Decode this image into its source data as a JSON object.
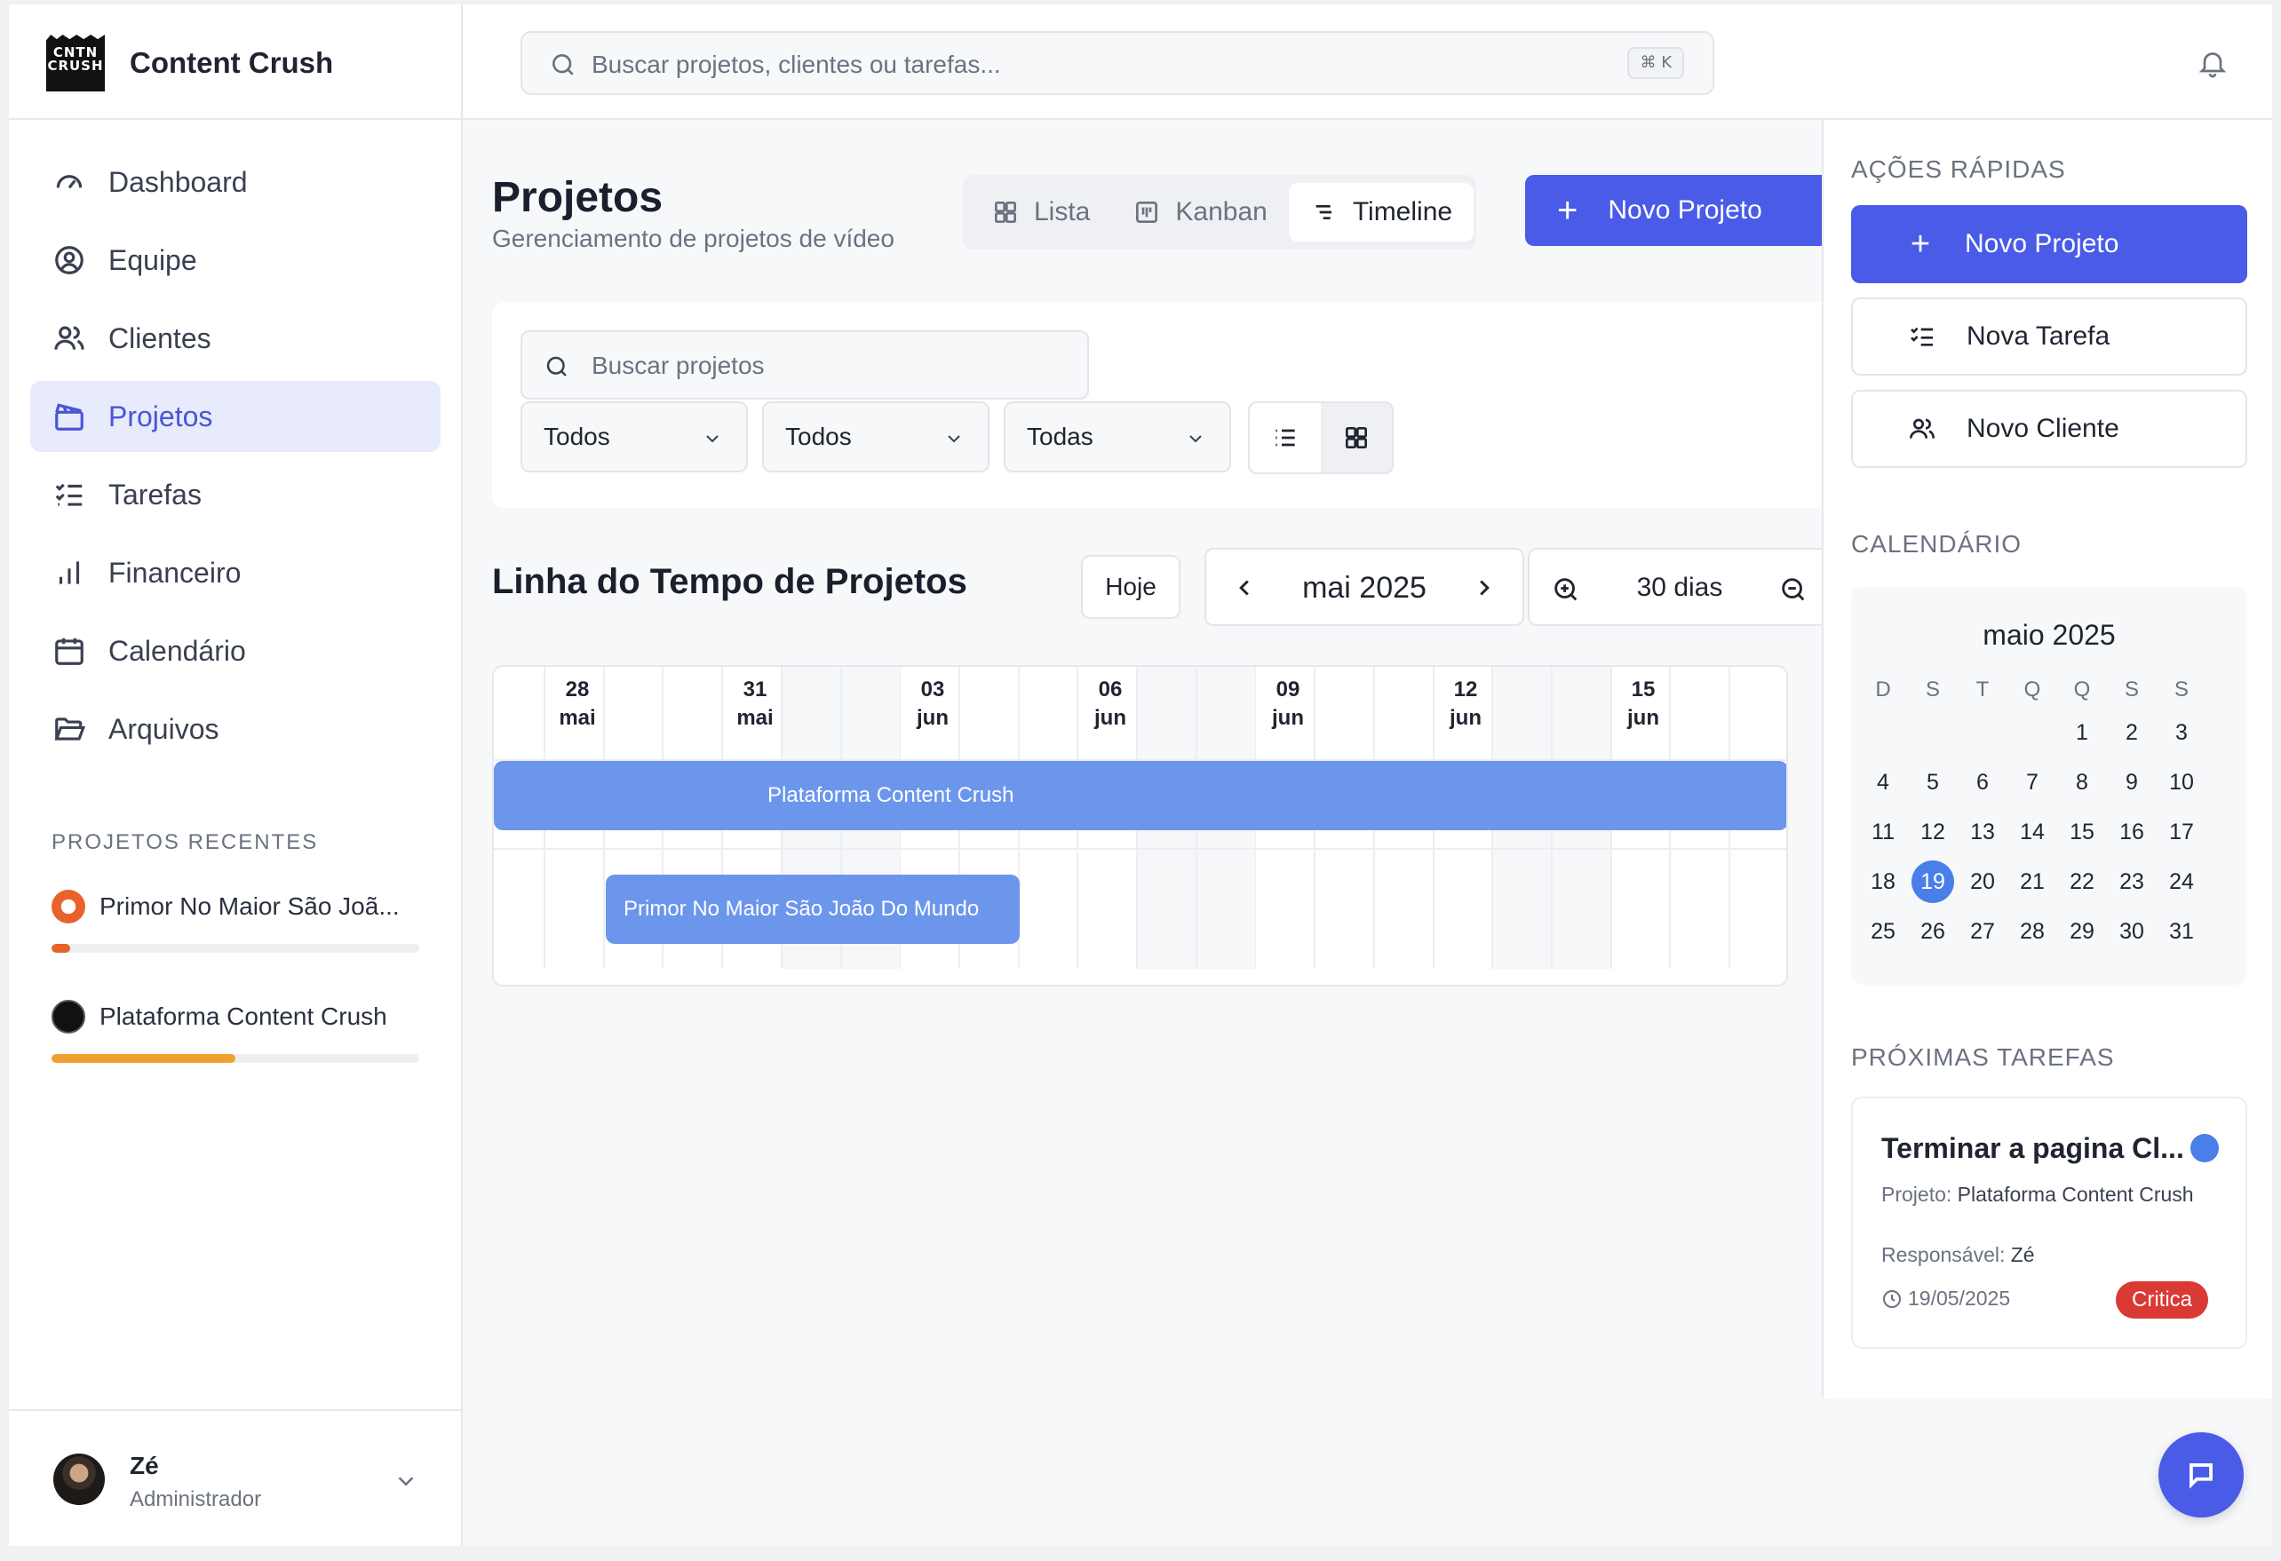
{
  "brand": {
    "logo_text": "CNTN CRUSH",
    "name": "Content Crush"
  },
  "search": {
    "placeholder": "Buscar projetos, clientes ou tarefas...",
    "shortcut": "⌘ K"
  },
  "sidebar": {
    "items": [
      {
        "label": "Dashboard",
        "icon": "gauge-icon",
        "active": false
      },
      {
        "label": "Equipe",
        "icon": "user-circle-icon",
        "active": false
      },
      {
        "label": "Clientes",
        "icon": "users-icon",
        "active": false
      },
      {
        "label": "Projetos",
        "icon": "clapperboard-icon",
        "active": true
      },
      {
        "label": "Tarefas",
        "icon": "checklist-icon",
        "active": false
      },
      {
        "label": "Financeiro",
        "icon": "bar-chart-icon",
        "active": false
      },
      {
        "label": "Calendário",
        "icon": "calendar-icon",
        "active": false
      },
      {
        "label": "Arquivos",
        "icon": "folder-icon",
        "active": false
      }
    ],
    "recent_label": "PROJETOS RECENTES",
    "recent": [
      {
        "name": "Primor No Maior São Joã...",
        "progress": 0.05,
        "color": "#e8632c"
      },
      {
        "name": "Plataforma Content Crush",
        "progress": 0.5,
        "color": "#f0a030"
      }
    ]
  },
  "user": {
    "name": "Zé",
    "role": "Administrador"
  },
  "main": {
    "title": "Projetos",
    "subtitle": "Gerenciamento de projetos de vídeo",
    "view_tabs": [
      {
        "label": "Lista",
        "icon": "grid-icon",
        "active": false
      },
      {
        "label": "Kanban",
        "icon": "kanban-icon",
        "active": false
      },
      {
        "label": "Timeline",
        "icon": "timeline-icon",
        "active": true
      }
    ],
    "new_project_label": "Novo Projeto",
    "filters": {
      "search_placeholder": "Buscar projetos",
      "selects": [
        "Todos",
        "Todos",
        "Todas"
      ]
    },
    "timeline": {
      "title": "Linha do Tempo de Projetos",
      "today_label": "Hoje",
      "month_label": "mai 2025",
      "zoom_label": "30 dias",
      "dates": [
        {
          "day": "28",
          "month": "mai"
        },
        {
          "day": "31",
          "month": "mai"
        },
        {
          "day": "03",
          "month": "jun"
        },
        {
          "day": "06",
          "month": "jun"
        },
        {
          "day": "09",
          "month": "jun"
        },
        {
          "day": "12",
          "month": "jun"
        },
        {
          "day": "15",
          "month": "jun"
        }
      ],
      "bars": [
        {
          "label": "Plataforma Content Crush",
          "color": "#6b96ec"
        },
        {
          "label": "Primor No Maior São João Do Mundo",
          "color": "#6b96ec"
        }
      ]
    }
  },
  "right_panel": {
    "quick_actions_label": "AÇÕES RÁPIDAS",
    "quick_actions": [
      {
        "label": "Novo Projeto",
        "icon": "plus-icon",
        "primary": true
      },
      {
        "label": "Nova Tarefa",
        "icon": "checklist-icon",
        "primary": false
      },
      {
        "label": "Novo Cliente",
        "icon": "users-icon",
        "primary": false
      }
    ],
    "calendar_label": "CALENDÁRIO",
    "calendar": {
      "title": "maio 2025",
      "weekdays": [
        "D",
        "S",
        "T",
        "Q",
        "Q",
        "S",
        "S"
      ],
      "weeks": [
        [
          "",
          "",
          "",
          "",
          "1",
          "2",
          "3"
        ],
        [
          "4",
          "5",
          "6",
          "7",
          "8",
          "9",
          "10"
        ],
        [
          "11",
          "12",
          "13",
          "14",
          "15",
          "16",
          "17"
        ],
        [
          "18",
          "19",
          "20",
          "21",
          "22",
          "23",
          "24"
        ],
        [
          "25",
          "26",
          "27",
          "28",
          "29",
          "30",
          "31"
        ]
      ],
      "today": "19"
    },
    "tasks_label": "PRÓXIMAS TAREFAS",
    "task": {
      "title": "Terminar a pagina Cl...",
      "project_label": "Projeto:",
      "project": "Plataforma Content Crush",
      "owner_label": "Responsável:",
      "owner": "Zé",
      "date": "19/05/2025",
      "priority": "Critica"
    }
  },
  "colors": {
    "accent": "#4a5be8",
    "accent_soft": "#e7ebfc",
    "bar": "#6b96ec",
    "critical": "#d93a34"
  }
}
